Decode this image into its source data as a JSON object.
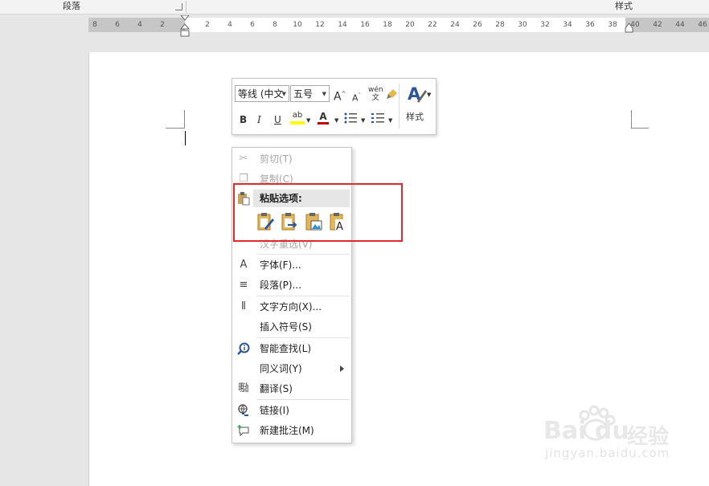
{
  "ribbon": {
    "paragraph_group": "段落",
    "styles_group": "样式"
  },
  "ruler": {
    "ticks": [
      "8",
      "6",
      "4",
      "2",
      "2",
      "4",
      "6",
      "8",
      "10",
      "12",
      "14",
      "16",
      "18",
      "20",
      "22",
      "24",
      "26",
      "28",
      "30",
      "32",
      "34",
      "36",
      "38",
      "40",
      "42",
      "44",
      "46"
    ]
  },
  "mini_toolbar": {
    "font_name": "等线 (中文",
    "font_size": "五号",
    "bold": "B",
    "italic": "I",
    "underline": "U",
    "font_color_glyph": "A",
    "styles_label": "样式"
  },
  "context_menu": {
    "cut": "剪切(T)",
    "copy": "复制(C)",
    "paste_options": "粘贴选项:",
    "hanzi_reselect": "汉字重选(V)",
    "font": "字体(F)...",
    "paragraph": "段落(P)...",
    "text_direction": "文字方向(X)...",
    "insert_symbol": "插入符号(S)",
    "smart_lookup": "智能查找(L)",
    "synonyms": "同义词(Y)",
    "translate": "翻译(S)",
    "link": "链接(I)",
    "new_comment": "新建批注(M)"
  },
  "watermark": {
    "brand": "Bai du",
    "cn": "经验",
    "url": "jingyan.baidu.com"
  },
  "colors": {
    "highlight_red": "#e02a2a",
    "accent_blue": "#2b579a"
  }
}
